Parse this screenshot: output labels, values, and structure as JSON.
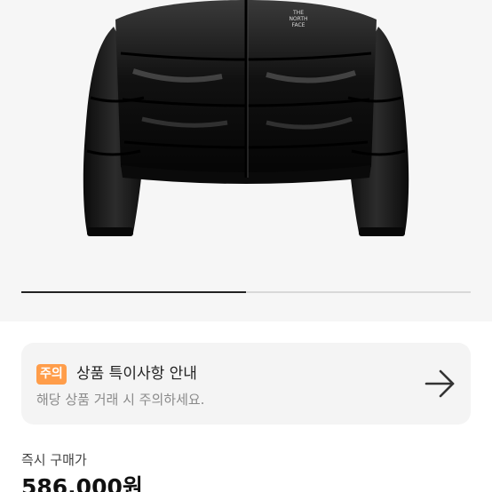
{
  "gallery": {
    "product_image": "black cropped padded puffer jacket",
    "brand_logo_text": "THE NORTH FACE",
    "progress": 0.5
  },
  "notice": {
    "badge": "주의",
    "title": "상품 특이사항 안내",
    "subtitle": "해당 상품 거래 시 주의하세요.",
    "arrow_icon": "arrow-right-icon",
    "badge_color": "#ff9d4a"
  },
  "price": {
    "label": "즉시 구매가",
    "value": "586,000원"
  }
}
